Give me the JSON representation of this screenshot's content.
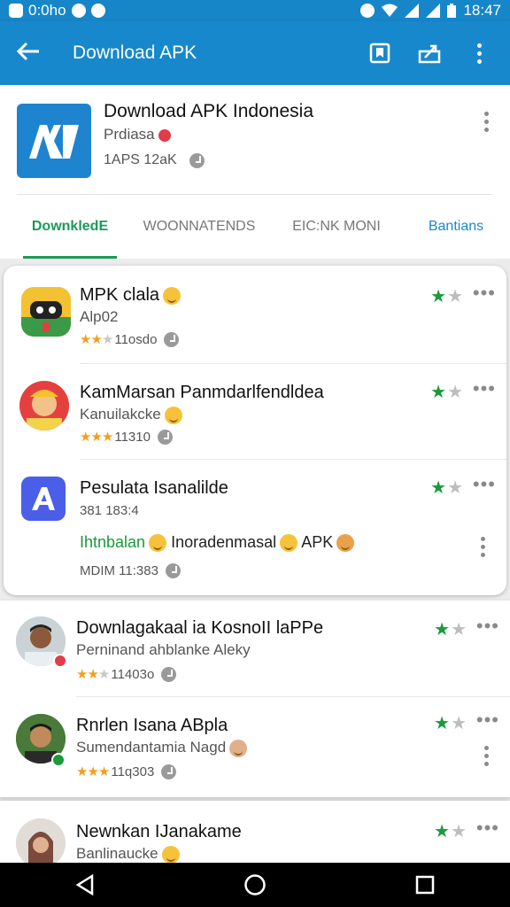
{
  "status_bar": {
    "left_text": "0:0ho",
    "time": "18:47"
  },
  "app_bar": {
    "title": "Download APK"
  },
  "app_header": {
    "name": "Download APK Indonesia",
    "developer": "Prdiasa",
    "meta": "1APS 12aK",
    "icon_text": "AK",
    "accent": "#1f84cf"
  },
  "tabs": [
    {
      "label": "DownkledE"
    },
    {
      "label": "WOONNATENDS"
    },
    {
      "label": "EIC:NK MONI"
    },
    {
      "label": "Bantians"
    }
  ],
  "items": [
    {
      "name": "MPK clala",
      "sub": "Alp02",
      "rating_text": "11osdo",
      "stars": 2.5
    },
    {
      "name": "KamMarsan Panmdarlfendldea",
      "sub": "Kanuilakcke",
      "rating_text": "11310",
      "stars": 3
    },
    {
      "name": "Pesulata Isanalilde",
      "sub": "381 183:4",
      "extra": "Inoradenmasal",
      "extra_green": "Ihtnbalan",
      "extra_tail": "APK",
      "time": "MDIM 11:383"
    },
    {
      "name": "Downlagakaal ia KosnoII laPPe",
      "sub": "Perninand ahblanke Aleky",
      "rating_text": "11403o",
      "stars": 2
    },
    {
      "name": "Rnrlen Isana ABpla",
      "sub": "Sumendantamia Nagd",
      "rating_text": "11q303",
      "stars": 3
    },
    {
      "name": "Newnkan IJanakame",
      "sub": "Banlinaucke"
    }
  ],
  "colors": {
    "primary": "#1888cc",
    "green": "#1a9a5a",
    "star": "#f0a020"
  }
}
